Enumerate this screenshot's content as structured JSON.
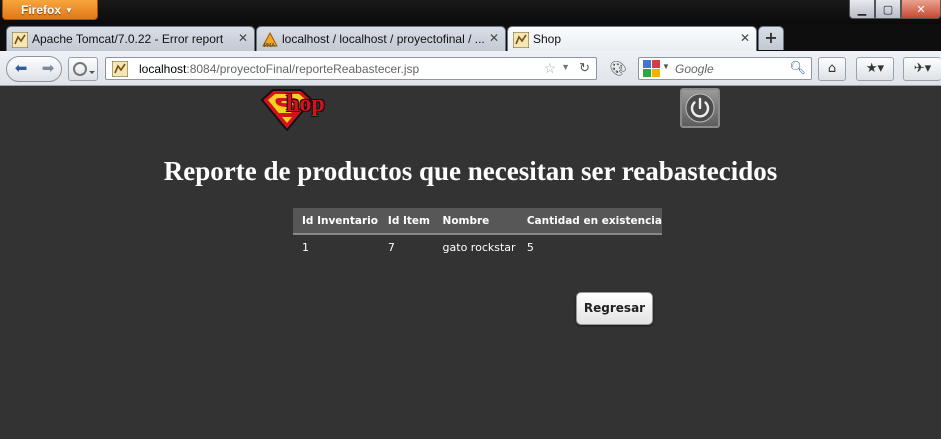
{
  "browser": {
    "app_menu_label": "Firefox",
    "tabs": [
      {
        "label": "Apache Tomcat/7.0.22 - Error report",
        "active": false
      },
      {
        "label": "localhost / localhost / proyectofinal / ...",
        "active": false
      },
      {
        "label": "Shop",
        "active": true
      }
    ],
    "new_tab_label": "+",
    "url": {
      "host": "localhost",
      "rest": ":8084/proyectoFinal/reporteReabastecer.jsp"
    },
    "search_placeholder": "Google"
  },
  "page": {
    "logo_text": "hop",
    "title": "Reporte de productos que necesitan ser reabastecidos",
    "table": {
      "headers": [
        "Id Inventario",
        "Id Item",
        "Nombre",
        "Cantidad en existencia"
      ],
      "rows": [
        [
          "1",
          "7",
          "gato rockstar",
          "5"
        ]
      ]
    },
    "back_button_label": "Regresar"
  },
  "colors": {
    "page_background": "#333333",
    "header_row": "#575757",
    "logo_red": "#d4111d",
    "firefox_orange": "#e0781a"
  }
}
